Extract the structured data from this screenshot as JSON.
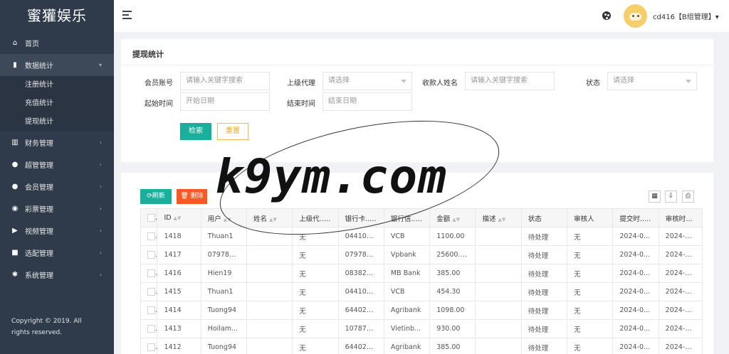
{
  "brand": "蜜獾娱乐",
  "sidebar": {
    "items": [
      {
        "label": "首页",
        "icon": "home-icon",
        "glyph": "⌂"
      },
      {
        "label": "数据统计",
        "icon": "bar-chart-icon",
        "glyph": "▮",
        "expanded": true,
        "children": [
          "注册统计",
          "充值统计",
          "提现统计"
        ]
      },
      {
        "label": "财务管理",
        "icon": "bank-icon",
        "glyph": "▥"
      },
      {
        "label": "超管管理",
        "icon": "user-icon",
        "glyph": "●"
      },
      {
        "label": "会员管理",
        "icon": "users-icon",
        "glyph": "●"
      },
      {
        "label": "彩票管理",
        "icon": "gamepad-icon",
        "glyph": "◉"
      },
      {
        "label": "视频管理",
        "icon": "video-icon",
        "glyph": "▶"
      },
      {
        "label": "选配管理",
        "icon": "camera-icon",
        "glyph": "■"
      },
      {
        "label": "系统管理",
        "icon": "gear-icon",
        "glyph": "✱"
      }
    ],
    "copyright": "Copyright © 2019. All rights reserved."
  },
  "topbar": {
    "user": "cd416【B组管理】▾"
  },
  "search_panel": {
    "title": "提现统计",
    "fields": {
      "member_account": {
        "label": "会员账号",
        "placeholder": "请输入关键字搜索"
      },
      "parent_agent": {
        "label": "上级代理",
        "placeholder": "请选择"
      },
      "payee_name": {
        "label": "收款人姓名",
        "placeholder": "请输入关键字搜索"
      },
      "status": {
        "label": "状态",
        "placeholder": "请选择"
      },
      "start_time": {
        "label": "起始时间",
        "placeholder": "开始日期"
      },
      "end_time": {
        "label": "结束时间",
        "placeholder": "结束日期"
      }
    },
    "search_label": "检索",
    "reset_label": "重置"
  },
  "table_panel": {
    "refresh_label": "刷新",
    "delete_label": "删除",
    "columns": [
      "ID",
      "用户",
      "姓名",
      "上级代...",
      "银行卡...",
      "银行信...",
      "金额",
      "描述",
      "状态",
      "审核人",
      "提交时...",
      "审核时间..."
    ],
    "rows": [
      {
        "id": "1418",
        "user": "Thuan1",
        "name": "",
        "agent": "无",
        "card": "044100...",
        "bank": "VCB",
        "amount": "1100.00",
        "desc": "",
        "status": "待处理",
        "reviewer": "无",
        "submit": "2024-0...",
        "review": "2024-03..."
      },
      {
        "id": "1417",
        "user": "079781...",
        "name": "",
        "agent": "无",
        "card": "079781...",
        "bank": "Vpbank",
        "amount": "25600.00",
        "desc": "",
        "status": "待处理",
        "reviewer": "无",
        "submit": "2024-0...",
        "review": "2024-03..."
      },
      {
        "id": "1416",
        "user": "Hien19",
        "name": "",
        "agent": "无",
        "card": "083827...",
        "bank": "MB Bank",
        "amount": "385.00",
        "desc": "",
        "status": "待处理",
        "reviewer": "无",
        "submit": "2024-0...",
        "review": "2024-03..."
      },
      {
        "id": "1415",
        "user": "Thuan1",
        "name": "",
        "agent": "无",
        "card": "044100...",
        "bank": "VCB",
        "amount": "454.30",
        "desc": "",
        "status": "待处理",
        "reviewer": "无",
        "submit": "2024-0...",
        "review": "2024-03..."
      },
      {
        "id": "1414",
        "user": "Tuong94",
        "name": "",
        "agent": "无",
        "card": "644028...",
        "bank": "Agribank",
        "amount": "1098.00",
        "desc": "",
        "status": "待处理",
        "reviewer": "无",
        "submit": "2024-0...",
        "review": "2024-03..."
      },
      {
        "id": "1413",
        "user": "Hoilam...",
        "name": "",
        "agent": "无",
        "card": "107875...",
        "bank": "Vietinb...",
        "amount": "930.00",
        "desc": "",
        "status": "待处理",
        "reviewer": "无",
        "submit": "2024-0...",
        "review": "2024-03..."
      },
      {
        "id": "1412",
        "user": "Tuong94",
        "name": "",
        "agent": "无",
        "card": "644028...",
        "bank": "Agribank",
        "amount": "385.00",
        "desc": "",
        "status": "待处理",
        "reviewer": "无",
        "submit": "2024-0...",
        "review": "2024-03..."
      }
    ]
  },
  "watermark": "k9ym.com",
  "colors": {
    "sidebar": "#2f3a4a",
    "primary": "#1aaf9d",
    "danger": "#ff5722",
    "pending": "#ff3b30",
    "ok": "#2e8b2e"
  }
}
